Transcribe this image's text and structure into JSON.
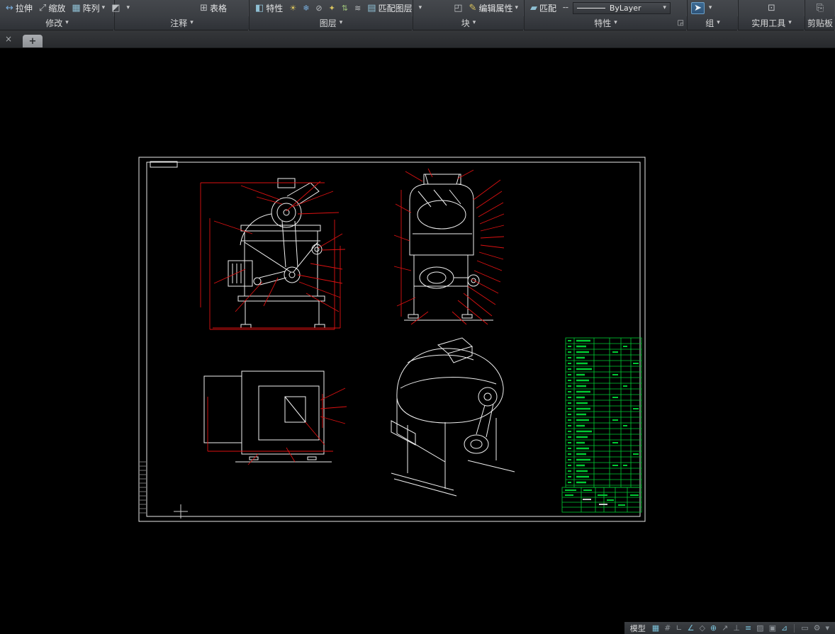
{
  "ribbon": {
    "buttons": {
      "stretch": "拉伸",
      "scale": "缩放",
      "array": "阵列",
      "table": "表格",
      "layer_properties": "特性",
      "match_layer": "匹配图层",
      "edit_attributes": "编辑属性",
      "match_properties": "匹配",
      "linetype_value": "ByLayer"
    },
    "panels": [
      {
        "label": "修改"
      },
      {
        "label": "注释"
      },
      {
        "label": "图层"
      },
      {
        "label": "块"
      },
      {
        "label": "特性"
      },
      {
        "label": "组"
      },
      {
        "label": "实用工具"
      },
      {
        "label": "剪贴板"
      }
    ]
  },
  "icons": {
    "chevron_down": "▾",
    "close": "×",
    "stretch": "↔",
    "scale": "⤢",
    "array": "▦",
    "fillet": "◩",
    "table": "⊞",
    "layer_properties": "◧",
    "layer_tools": [
      "☀",
      "❄",
      "⊘",
      "✦",
      "⇅",
      "≋"
    ],
    "match_layer": "▤",
    "block": "◰",
    "edit_attributes": "✎",
    "match_properties": "▰",
    "linetype_dash": "╌",
    "group_select": "➤",
    "calculator": "⊡",
    "paste": "⎘",
    "dialog_launcher": "◲"
  },
  "tabbar": {
    "new_tab": "+"
  },
  "statusbar": {
    "model_label": "模型",
    "main_icons": [
      "▦",
      "#",
      "∟",
      "∠",
      "◇",
      "⊕",
      "↗",
      "⊥",
      "≡",
      "▨",
      "▣",
      "⊿"
    ],
    "right_icons": [
      "▭",
      "⚙",
      "▾"
    ]
  },
  "colors": {
    "annotation_red": "#dd1111",
    "geometry_white": "#f0f0f0",
    "table_green": "#00cc33",
    "canvas_black": "#000000",
    "selection_blue": "#2d5378"
  }
}
